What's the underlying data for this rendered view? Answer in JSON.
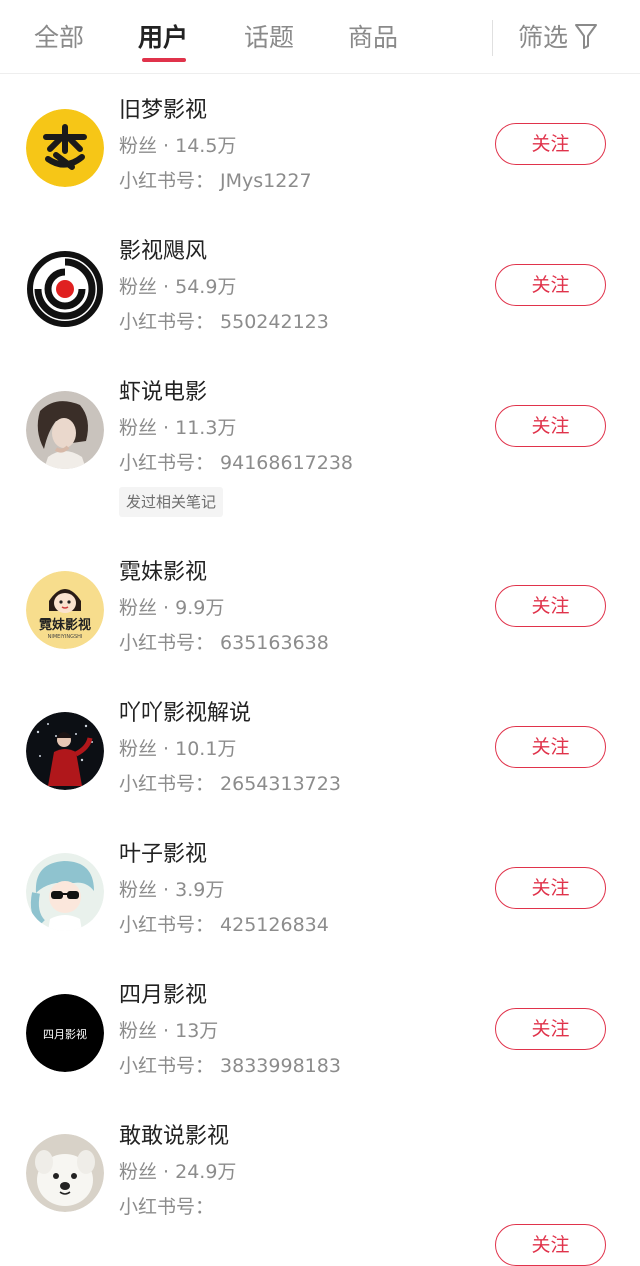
{
  "tabs": [
    {
      "label": "全部",
      "active": false
    },
    {
      "label": "用户",
      "active": true
    },
    {
      "label": "话题",
      "active": false
    },
    {
      "label": "商品",
      "active": false
    }
  ],
  "filter": {
    "label": "筛选",
    "icon": "filter-funnel-icon"
  },
  "colors": {
    "accent": "#e0334b",
    "muted": "#8c8c8c"
  },
  "users": [
    {
      "name": "旧梦影视",
      "fans": "粉丝 · 14.5万",
      "id": "小红书号： JMys1227",
      "follow": "关注",
      "avatar": "yellow-dream-logo-avatar"
    },
    {
      "name": "影视飓风",
      "fans": "粉丝 · 54.9万",
      "id": "小红书号： 550242123",
      "follow": "关注",
      "avatar": "spiral-red-dot-logo-avatar"
    },
    {
      "name": "虾说电影",
      "fans": "粉丝 · 11.3万",
      "id": "小红书号： 94168617238",
      "tag": "发过相关笔记",
      "follow": "关注",
      "avatar": "woman-portrait-avatar"
    },
    {
      "name": "霓妹影视",
      "fans": "粉丝 · 9.9万",
      "id": "小红书号： 635163638",
      "follow": "关注",
      "avatar": "cartoon-girl-logo-avatar",
      "avatar_text": "霓妹影视",
      "avatar_subtext": "NIMEIYINGSHI"
    },
    {
      "name": "吖吖影视解说",
      "fans": "粉丝 · 10.1万",
      "id": "小红书号： 2654313723",
      "follow": "关注",
      "avatar": "red-dress-figure-avatar"
    },
    {
      "name": "叶子影视",
      "fans": "粉丝 · 3.9万",
      "id": "小红书号： 425126834",
      "follow": "关注",
      "avatar": "cartoon-sunglasses-avatar"
    },
    {
      "name": "四月影视",
      "fans": "粉丝 · 13万",
      "id": "小红书号： 3833998183",
      "follow": "关注",
      "avatar": "black-text-logo-avatar",
      "avatar_text": "四月影视"
    },
    {
      "name": "敢敢说影视",
      "fans": "粉丝 · 24.9万",
      "id": "小红书号： ",
      "follow": "关注",
      "avatar": "white-dog-avatar"
    }
  ]
}
